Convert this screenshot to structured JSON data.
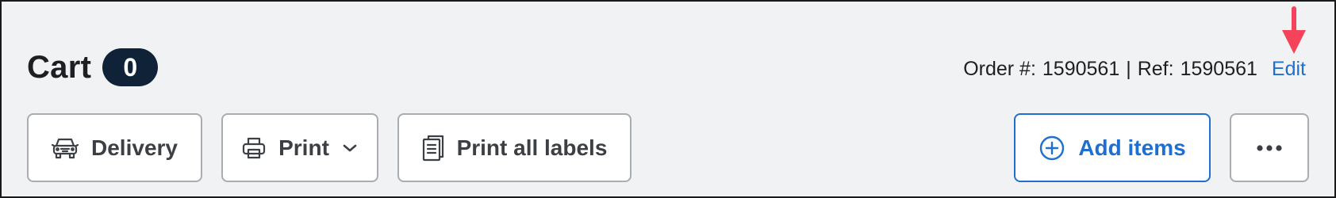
{
  "header": {
    "title": "Cart",
    "count": "0"
  },
  "order": {
    "order_label": "Order #:",
    "order_number": "1590561",
    "separator": "|",
    "ref_label": "Ref:",
    "ref_number": "1590561",
    "edit_label": "Edit"
  },
  "toolbar": {
    "delivery_label": "Delivery",
    "print_label": "Print",
    "print_all_labels_label": "Print all labels",
    "add_items_label": "Add items"
  },
  "icons": {
    "delivery": "car-icon",
    "print": "printer-icon",
    "print_dropdown": "chevron-down-icon",
    "print_all_labels": "documents-icon",
    "add_items": "plus-circle-icon",
    "more": "more-horizontal-icon",
    "annotation": "arrow-down-icon"
  },
  "colors": {
    "background": "#f1f2f4",
    "badge": "#0f2238",
    "accent": "#1f6fd1",
    "annotation_arrow": "#f4435a",
    "button_border": "#a9adb2",
    "text": "#1d1f22"
  }
}
